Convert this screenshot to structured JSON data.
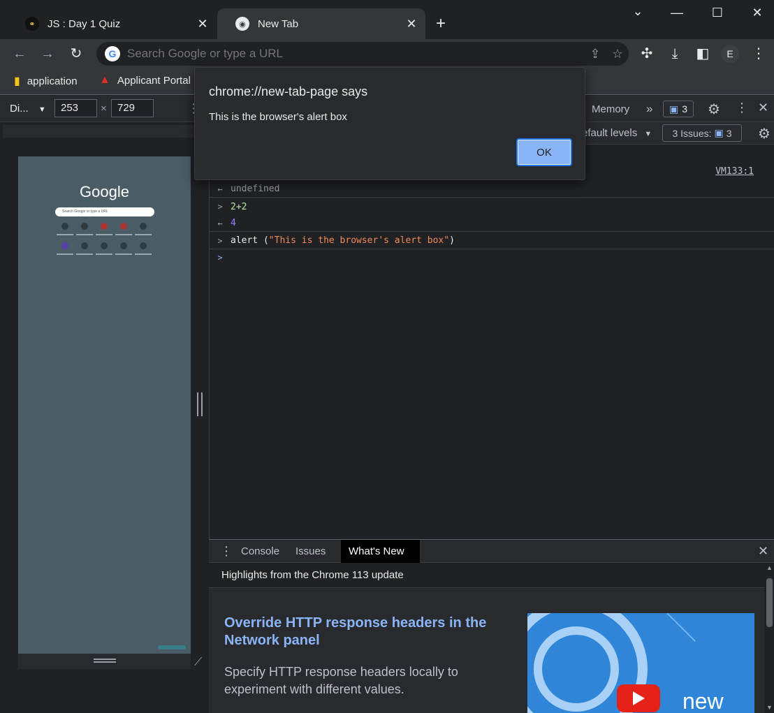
{
  "tabs": [
    {
      "title": "JS : Day 1 Quiz",
      "active": false
    },
    {
      "title": "New Tab",
      "active": true
    }
  ],
  "toolbar": {
    "omnibox_placeholder": "Search Google or type a URL",
    "avatar_initial": "E"
  },
  "bookmarks": [
    {
      "label": "application",
      "icon": "folder-icon"
    },
    {
      "label": "Applicant Portal",
      "icon": "applicant-portal-icon"
    }
  ],
  "device_toolbar": {
    "device": "Di...",
    "width": "253",
    "height": "729",
    "times": "×"
  },
  "emulated_page": {
    "logo": "Google",
    "search_placeholder": "Search Google or type a URL"
  },
  "devtools": {
    "panel_memory": "Memory",
    "more_tabs": "»",
    "message_count": "3",
    "levels": "efault levels",
    "issues_label": "3 Issues:",
    "issues_count": "3",
    "source_link": "VM133:1"
  },
  "console": {
    "lines": [
      {
        "prefix": "←",
        "text": "undefined",
        "kind": "result-undefined"
      },
      {
        "prefix": ">",
        "text": "2+2",
        "kind": "input"
      },
      {
        "prefix": "←",
        "text": "4",
        "kind": "result-number"
      },
      {
        "prefix": ">",
        "text_fn": "alert (",
        "text_str": "\"This is the browser's alert box\"",
        "text_end": ")",
        "kind": "input"
      }
    ],
    "prompt": ">"
  },
  "drawer": {
    "tabs": [
      "Console",
      "Issues",
      "What's New"
    ],
    "active_tab": "What's New",
    "header": "Highlights from the Chrome 113 update",
    "feature_title": "Override HTTP response headers in the Network panel",
    "feature_desc": "Specify HTTP response headers locally to experiment with different values.",
    "thumb_text": "new"
  },
  "alert": {
    "title": "chrome://new-tab-page says",
    "message": "This is the browser's alert box",
    "ok_label": "OK"
  },
  "colors": {
    "accent": "#8ab4f8",
    "string": "#f28b54",
    "number": "#9980ff",
    "input": "#b5e6a3"
  }
}
